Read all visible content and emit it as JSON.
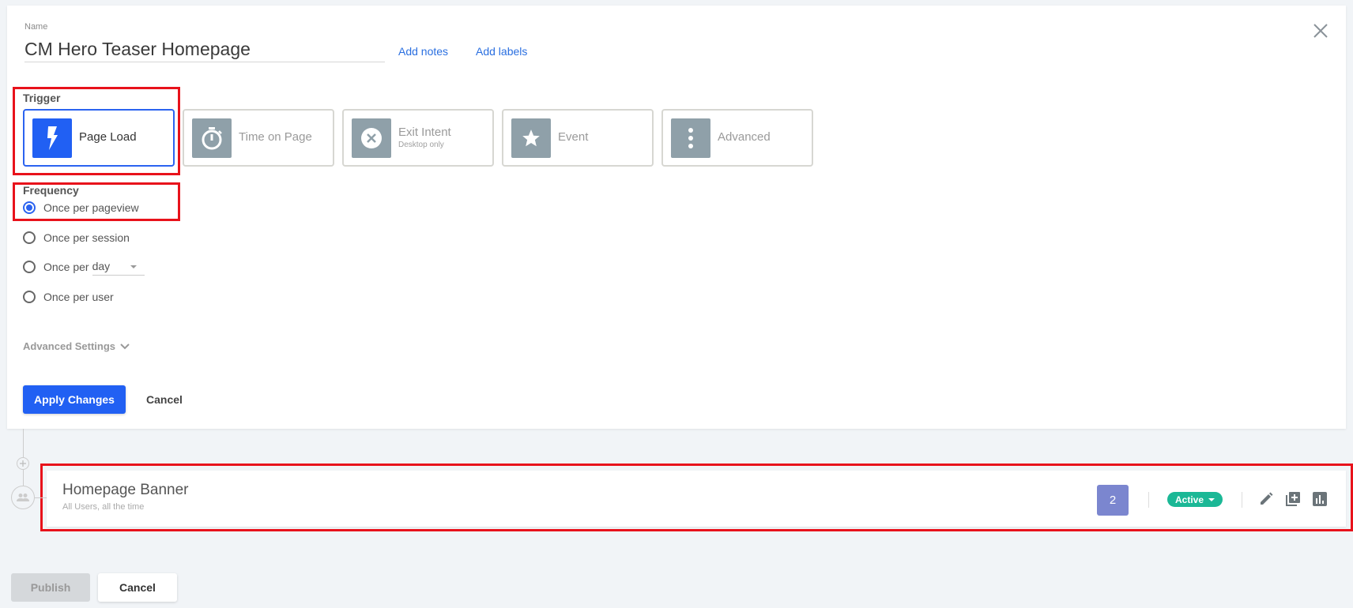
{
  "form": {
    "name_label": "Name",
    "name_value": "CM Hero Teaser Homepage",
    "add_notes": "Add notes",
    "add_labels": "Add labels",
    "close_icon": "close-icon"
  },
  "trigger": {
    "label": "Trigger",
    "selected": "Page Load",
    "options": [
      {
        "label": "Page Load",
        "icon": "lightning-icon",
        "selected": true
      },
      {
        "label": "Time on Page",
        "icon": "stopwatch-icon",
        "selected": false
      },
      {
        "label": "Exit Intent",
        "sublabel": "Desktop only",
        "icon": "exit-circle-icon",
        "selected": false
      },
      {
        "label": "Event",
        "icon": "star-icon",
        "selected": false
      },
      {
        "label": "Advanced",
        "icon": "more-vertical-icon",
        "selected": false
      }
    ]
  },
  "frequency": {
    "label": "Frequency",
    "options": [
      {
        "label": "Once per pageview",
        "checked": true
      },
      {
        "label": "Once per session",
        "checked": false
      },
      {
        "label": "Once per",
        "checked": false,
        "select_value": "day"
      },
      {
        "label": "Once per user",
        "checked": false
      }
    ]
  },
  "advanced_settings_label": "Advanced Settings",
  "actions": {
    "apply": "Apply Changes",
    "cancel": "Cancel"
  },
  "experience": {
    "title": "Homepage Banner",
    "subtitle": "All Users, all the time",
    "variant_count": "2",
    "status": "Active",
    "status_color": "#1bb896",
    "variant_color": "#7b86cf"
  },
  "footer": {
    "publish": "Publish",
    "cancel": "Cancel"
  },
  "colors": {
    "accent": "#2160f3",
    "highlight_annotation": "#e8121b"
  }
}
